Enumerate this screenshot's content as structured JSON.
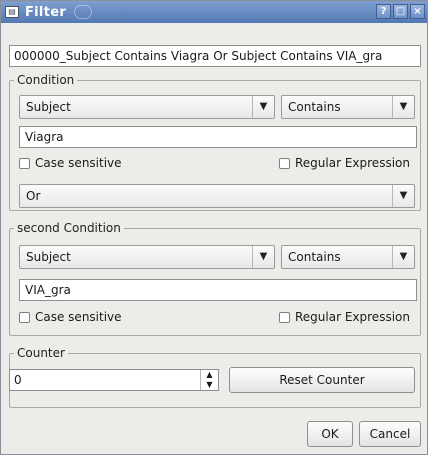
{
  "window": {
    "title": "Filter",
    "help_button": "?",
    "minimize_button": "□",
    "close_button": "×"
  },
  "filter_name": "000000_Subject Contains Viagra Or Subject Contains VIA_gra",
  "condition1": {
    "legend": "Condition",
    "field": "Subject",
    "operator": "Contains",
    "value": "Viagra",
    "case_sensitive_label": "Case sensitive",
    "regex_label": "Regular Expression",
    "combiner": "Or"
  },
  "condition2": {
    "legend": "second Condition",
    "field": "Subject",
    "operator": "Contains",
    "value": "VIA_gra",
    "case_sensitive_label": "Case sensitive",
    "regex_label": "Regular Expression"
  },
  "counter": {
    "legend": "Counter",
    "value": "0",
    "reset_label": "Reset Counter"
  },
  "buttons": {
    "ok": "OK",
    "cancel": "Cancel"
  }
}
